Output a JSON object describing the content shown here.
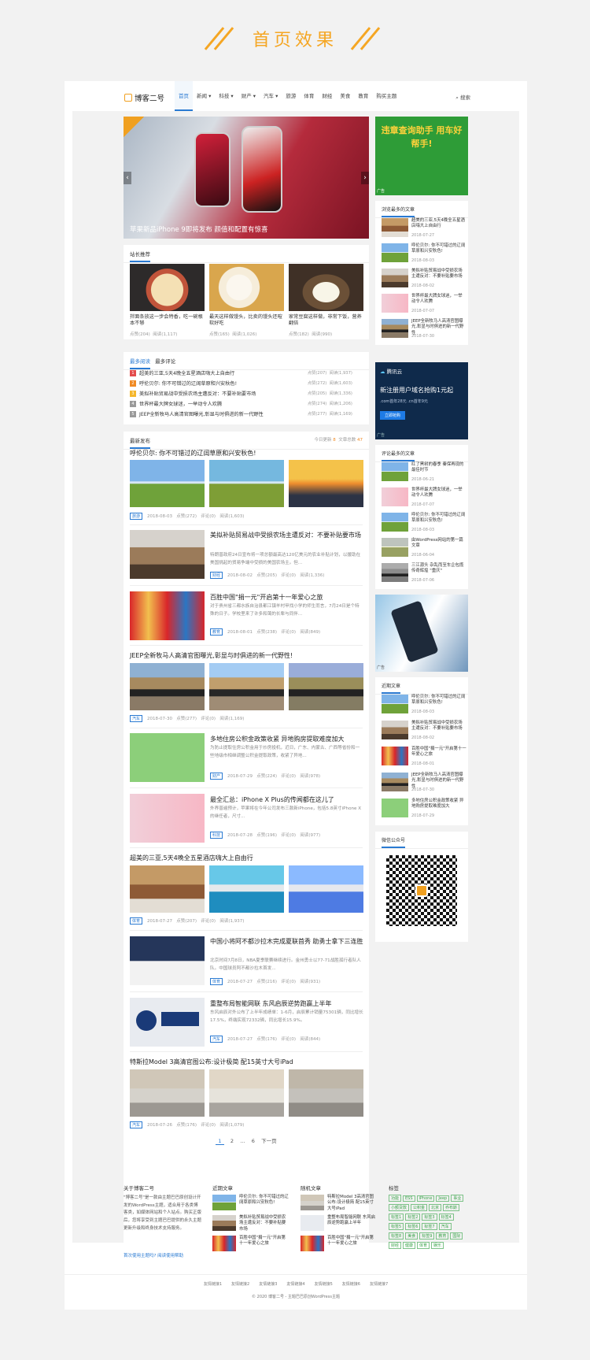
{
  "hero": {
    "title": "首页效果",
    "color": "#f5a623"
  },
  "nav": {
    "logo": "博客二号",
    "items": [
      "首页",
      "新闻",
      "科技",
      "财产",
      "汽车",
      "旅游",
      "体育",
      "财经",
      "美食",
      "教育",
      "购买主题"
    ],
    "search": "搜索",
    "accent": "#2a7ad2"
  },
  "slider": {
    "caption": "苹果新品iPhone 9即将发布 颜值和配置有惊喜"
  },
  "recommend": {
    "heading": "站长推荐",
    "items": [
      {
        "title": "拌面条放这一步会特香，吃一碗根本不够",
        "views": "点赞(204)",
        "meta": "阅读(1,117)"
      },
      {
        "title": "最天这样做馒头，比卖的馒头还暄软好吃",
        "views": "点赞(165)",
        "meta": "阅读(1,026)"
      },
      {
        "title": "家常豆腐这样做，非常下饭，营养翻倍",
        "views": "点赞(182)",
        "meta": "阅读(990)"
      }
    ]
  },
  "ranking": {
    "tabs": [
      "最多阅读",
      "最多评论"
    ],
    "items": [
      {
        "n": "1",
        "title": "超美的三亚,5天4晚全五星酒店嗨大上自由行",
        "likes": "点赞(207)",
        "reads": "阅读(1,937)",
        "color": "#e34c4c"
      },
      {
        "n": "2",
        "title": "呼伦贝尔: 你不可错过的辽阔草原和兴安秋色!",
        "likes": "点赞(272)",
        "reads": "阅读(1,603)",
        "color": "#f08a24"
      },
      {
        "n": "3",
        "title": "美拟补贴贸易战中受损农场主遭反对：不要补贴要市场",
        "likes": "点赞(205)",
        "reads": "阅读(1,336)",
        "color": "#f5b72c"
      },
      {
        "n": "4",
        "title": "世界杯最大牌女球迷，一举动令人欢腾",
        "likes": "点赞(274)",
        "reads": "阅读(1,206)",
        "color": "#9a9a9a"
      },
      {
        "n": "5",
        "title": "JEEP全新牧马人高清官图曝光,彰显与时俱进的新一代野性",
        "likes": "点赞(277)",
        "reads": "阅读(1,169)",
        "color": "#9a9a9a"
      }
    ]
  },
  "latest": {
    "heading": "最新发布",
    "today": "今日更新",
    "today_count": "8",
    "total": "文章总数",
    "total_count": "47"
  },
  "articles": [
    {
      "title": "呼伦贝尔: 你不可错过的辽阔草原和兴安秋色!",
      "tag": "旅游",
      "date": "2018-08-03",
      "likes": "点赞(272)",
      "comments": "评论(0)",
      "reads": "阅读(1,603)"
    },
    {
      "title": "美拟补贴贸易战中受损农场主遭反对：不要补贴要市场",
      "desc": "特朗普政府24日宣布将一项总额最高达120亿美元的农业补贴计划，以援助在美国挑起的贸易争端中受损的美国农场主。但...",
      "tag": "财经",
      "date": "2018-08-02",
      "likes": "点赞(205)",
      "comments": "评论(0)",
      "reads": "阅读(1,336)"
    },
    {
      "title": "百胜中国\"捐一元\"开启第十一年爱心之旅",
      "desc": "对于贵州省三都水族自治县都江镇羊村甲找小学的师生而言，7月24日是个特殊的日子。学校里来了许多和蔼的长辈与同伴...",
      "tag": "教育",
      "date": "2018-08-01",
      "likes": "点赞(238)",
      "comments": "评论(0)",
      "reads": "阅读(849)"
    },
    {
      "title": "JEEP全新牧马人高清官图曝光,彰显与时俱进的新一代野性!",
      "tag": "汽车",
      "date": "2018-07-30",
      "likes": "点赞(277)",
      "comments": "评论(0)",
      "reads": "阅读(1,169)"
    },
    {
      "title": "多地住房公积金政策收紧 异地购房提取难度加大",
      "desc": "为防止提取住房公积金用于炒房投机，近日，广东、内蒙古、广西等省份和一些地级市相继调整公积金提取政策，收紧了异地...",
      "tag": "财产",
      "date": "2018-07-29",
      "likes": "点赞(224)",
      "comments": "评论(0)",
      "reads": "阅读(978)"
    },
    {
      "title": "最全汇总：iPhone X Plus的传闻都在这儿了",
      "desc": "外界普遍预计，苹果将在今年公司发布三款新iPhone，包括5.8英寸iPhone X的继任者，尺寸...",
      "tag": "科技",
      "date": "2018-07-28",
      "likes": "点赞(196)",
      "comments": "评论(0)",
      "reads": "阅读(977)"
    },
    {
      "title": "超美的三亚,5天4晚全五星酒店嗨大上自由行",
      "tag": "体育",
      "date": "2018-07-27",
      "likes": "点赞(207)",
      "comments": "评论(0)",
      "reads": "阅读(1,937)"
    },
    {
      "title": "中国小将阿不都沙拉木完成夏联首秀 助勇士拿下三连胜",
      "desc": "北京时间7月8日，NBA夏季联赛继续进行。金州勇士以77-71战胜孤行者队人队。中国球员阿不都沙拉木首发...",
      "tag": "体育",
      "date": "2018-07-27",
      "likes": "点赞(216)",
      "comments": "评论(0)",
      "reads": "阅读(931)"
    },
    {
      "title": "重整布局智能网联 东风启辰逆势跑赢上半年",
      "desc": "东风启辰对外公布了上半年成绩单：1-6月，启辰累计销量75301辆，同比增长17.5%，终端实现72332辆，同比增长15.9%。",
      "tag": "汽车",
      "date": "2018-07-27",
      "likes": "点赞(176)",
      "comments": "评论(0)",
      "reads": "阅读(844)"
    },
    {
      "title": "特斯拉Model 3高清官图公布:设计极简 配15英寸大号iPad",
      "tag": "汽车",
      "date": "2018-07-26",
      "likes": "点赞(176)",
      "comments": "评论(0)",
      "reads": "阅读(1,079)"
    }
  ],
  "pagination": [
    "1",
    "2",
    "...",
    "6",
    "下一页"
  ],
  "sidebar": {
    "ad1_label": "广告",
    "ad1_text": "违章查询助手 用车好帮手!",
    "popular_heading": "浏览最多的文章",
    "popular": [
      {
        "title": "超美的三亚,5天4晚全五星酒店嗨大上自由行",
        "date": "2018-07-27"
      },
      {
        "title": "呼伦贝尔: 你不可错过的辽阔草原和兴安秋色!",
        "date": "2018-08-03"
      },
      {
        "title": "美拟补贴贸易战中受损农场主遭反对：不要补贴要市场",
        "date": "2018-08-02"
      },
      {
        "title": "世界杯最大牌女球迷，一举动令人欢腾",
        "date": "2018-07-07"
      },
      {
        "title": "JEEP全新牧马人高清官图曝光,彰显与时俱进的新一代野性",
        "date": "2018-07-30"
      }
    ],
    "ad2_brand": "腾讯云",
    "ad2_text": "新注册用户域名抢购1元起",
    "ad2_sub": ".com首年28元 .cn首年9元",
    "ad2_btn": "立即抢购",
    "ad2_label": "广告",
    "commented_heading": "评论最多的文章",
    "commented": [
      {
        "title": "红了黑树的春季 秦保再现的最佳时节",
        "date": "2018-06-21"
      },
      {
        "title": "世界杯最大牌女球迷，一举动令人欢腾",
        "date": "2018-07-07"
      },
      {
        "title": "呼伦贝尔: 你不可错过的辽阔草原和兴安秋色!",
        "date": "2018-08-03"
      },
      {
        "title": "由WordPress网站的第一篇文章",
        "date": "2018-06-04"
      },
      {
        "title": "三江源头 杂乱而至车企包揽传奇辉煌 \"重庆\"",
        "date": "2018-07-06"
      }
    ],
    "ad3_label": "广告",
    "recent_heading": "近期文章",
    "recent": [
      {
        "title": "呼伦贝尔: 你不可错过的辽阔草原和兴安秋色!",
        "date": "2018-08-03"
      },
      {
        "title": "美拟补贴贸易战中受损农场主遭反对：不要补贴要市场",
        "date": "2018-08-02"
      },
      {
        "title": "百胜中国\"捐一元\"开启第十一年爱心之旅",
        "date": "2018-08-01"
      },
      {
        "title": "JEEP全新牧马人高清官图曝光,彰显与时俱进的新一代野性",
        "date": "2018-07-30"
      },
      {
        "title": "多地住房公积金政策收紧 异地购房提取难度加大",
        "date": "2018-07-29"
      }
    ],
    "wechat_heading": "微信公众号"
  },
  "footer": {
    "about_h": "关于博客二号",
    "about_p": "\"博客二号\"是一款由主题巴巴原创设计开发的WordPress主题，适合用于各类博客类，如媒体网站和个人站点。购买正版后，您将享受到主题巴巴提供的永久主题更新升级和终身技术支持服务。",
    "about_link": "首次使用主题吗? 阅读使用帮助",
    "recent_h": "近期文章",
    "recent": [
      "呼伦贝尔: 你不可错过的辽阔草原和兴安秋色!",
      "美拟补贴贸易战中受损农场主遭反对：不要补贴要市场",
      "百胜中国\"捐一元\"开启第十一年爱心之旅"
    ],
    "random_h": "随机文章",
    "random": [
      "特斯拉Model 3高清官图公布:设计极简 配15英寸大号iPad",
      "重整布局智能网联 东风启辰逆势跑赢上半年",
      "百胜中国\"捐一元\"开启第十一年爱心之旅"
    ],
    "tags_h": "标签",
    "tags": [
      "功能",
      "ESS",
      "iPhone",
      "Jeep",
      "事业",
      "小额贷款",
      "公积金",
      "北京",
      "乔布斯",
      "标签1",
      "标签2",
      "标签3",
      "标签4",
      "标签5",
      "标签6",
      "标签7",
      "汽车",
      "标签8",
      "美食",
      "标签9",
      "教育",
      "国际",
      "财经",
      "健康",
      "体育",
      "娱乐"
    ],
    "links": [
      "友情链接1",
      "友情链接2",
      "友情链接3",
      "友情链接4",
      "友情链接5",
      "友情链接6",
      "友情链接7"
    ],
    "copyright": "© 2020 博客二号 - 主题巴巴原创WordPress主题"
  }
}
